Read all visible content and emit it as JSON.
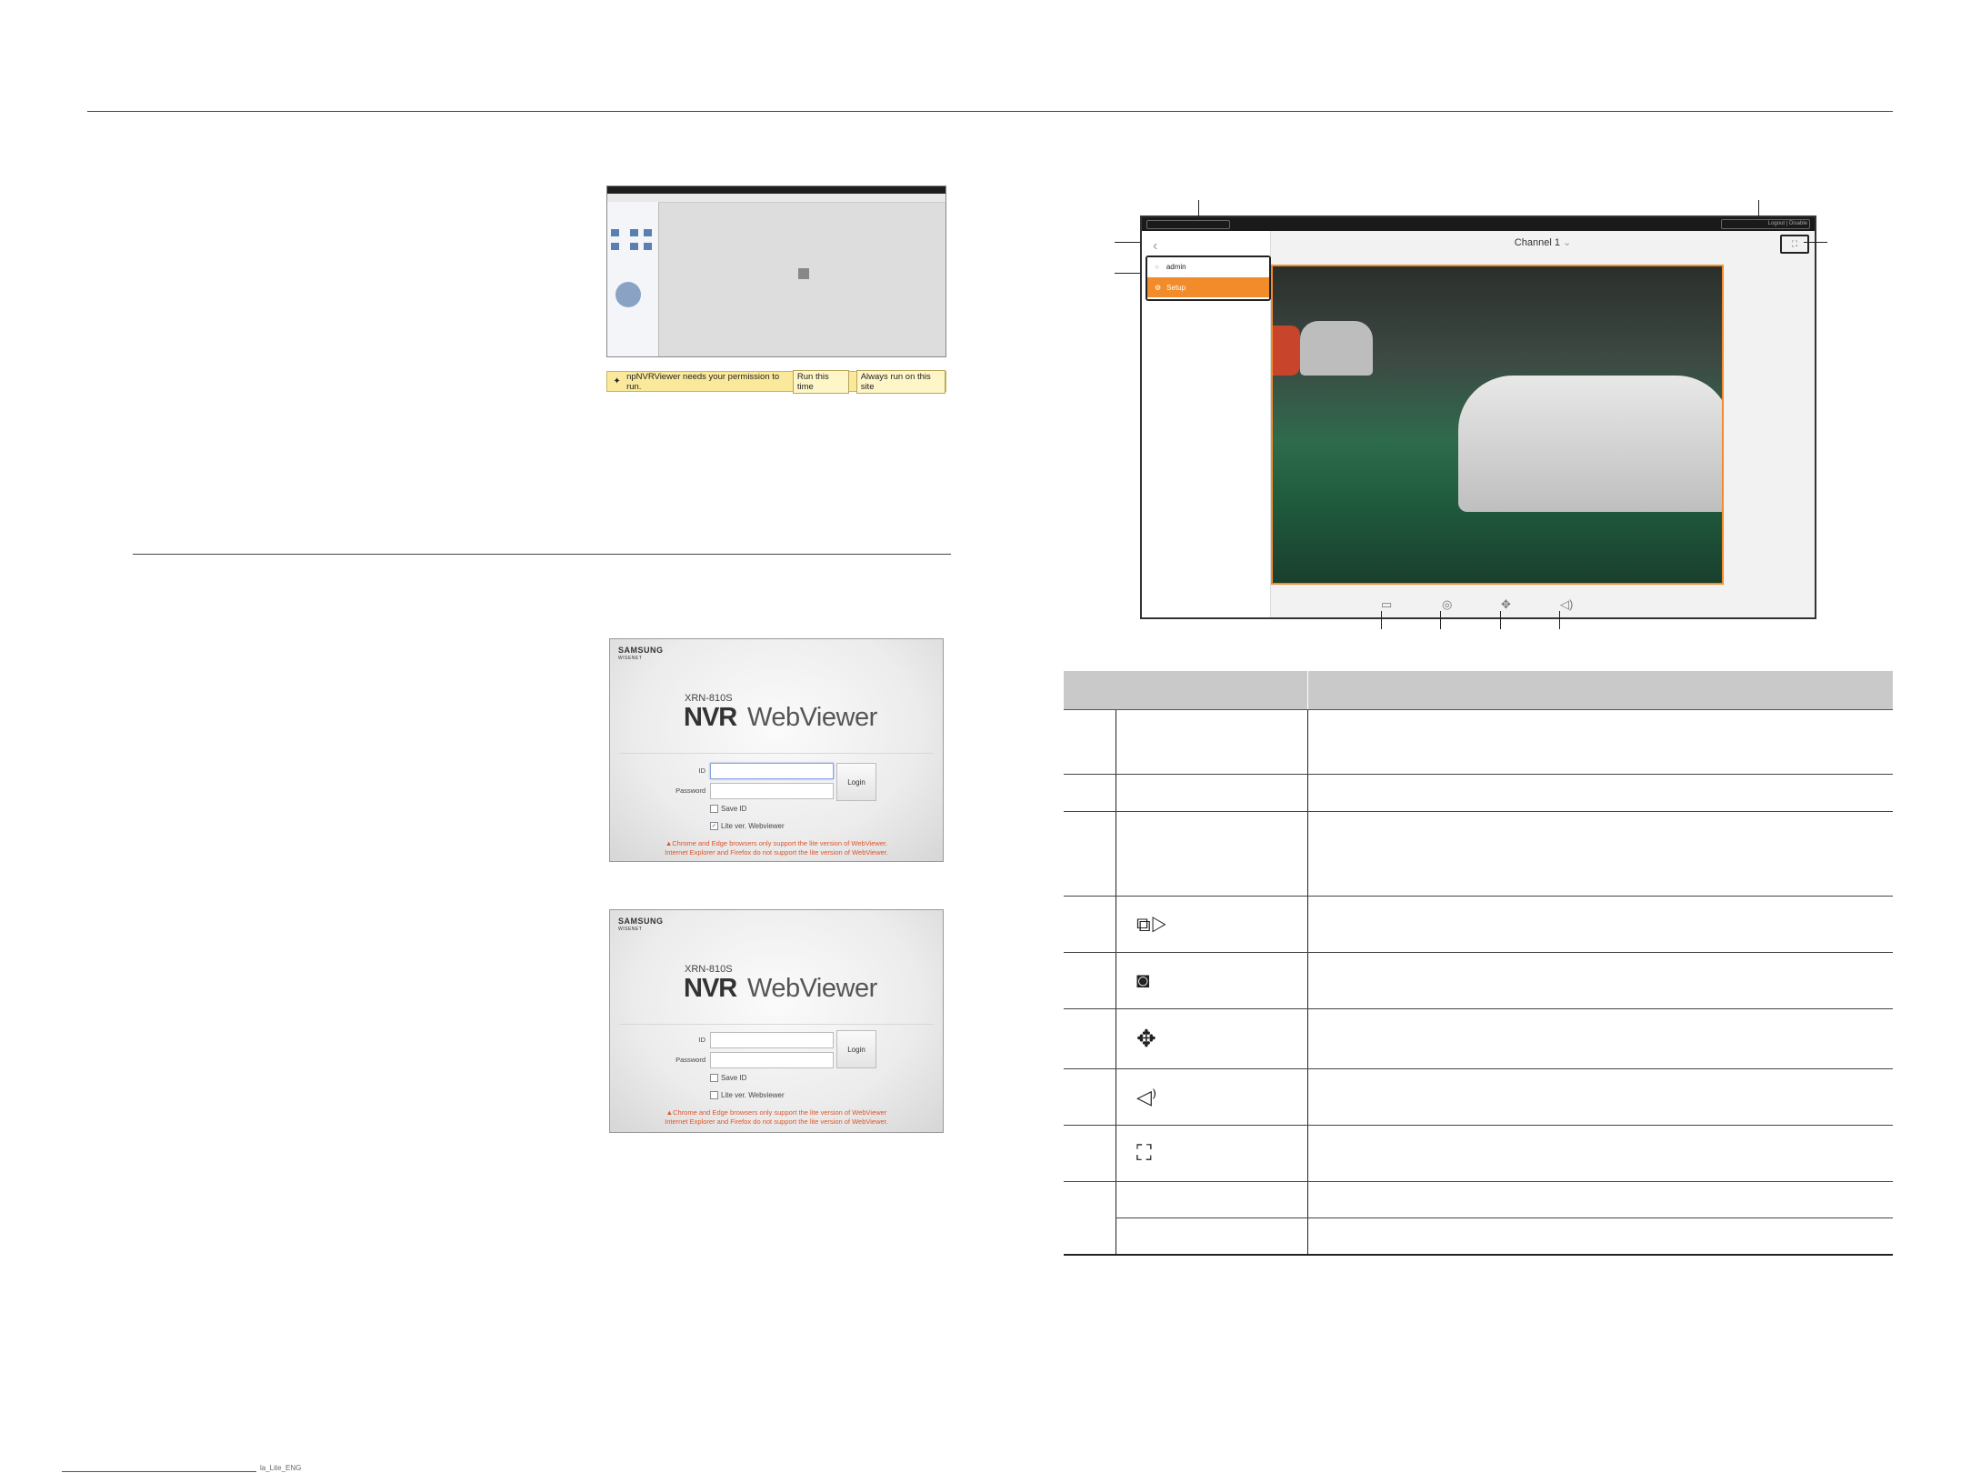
{
  "plugin_bar": {
    "message": "npNVRViewer needs your permission to run.",
    "run_once": "Run this time",
    "always_run": "Always run on this site"
  },
  "login": {
    "brand": "SAMSUNG",
    "brand_sub": "WISENET",
    "model": "XRN-810S",
    "title_bold": "NVR",
    "title_light": "WebViewer",
    "id_label": "ID",
    "password_label": "Password",
    "login_button": "Login",
    "save_id": "Save ID",
    "lite_ver": "Lite ver. Webviewer",
    "warning_line1": "▲Chrome and Edge browsers only support the lite version of WebViewer.",
    "warning_line2": "Internet Explorer and Firefox do not support the lite version of WebViewer.",
    "warning_line1_b": "▲Chrome and Edge browsers only support the lite version of WebViewer",
    "warning_line2_b": "Internet Explorer and Firefox do not support the lite version of WebViewer."
  },
  "viewer": {
    "channel_title": "Channel 1",
    "menu_admin": "admin",
    "menu_setup": "Setup",
    "topbar_right": "Logout | Disable"
  },
  "colors": {
    "accent_orange": "#f28c2a",
    "table_header": "#c9c9c9",
    "plugin_bar": "#fbe99b",
    "warning": "#e0542a"
  },
  "table_icons": [
    "record-icon",
    "camera-icon",
    "move-arrows-icon",
    "speaker-icon",
    "fullscreen-icon"
  ],
  "footer": {
    "text": "la_Lite_ENG"
  }
}
